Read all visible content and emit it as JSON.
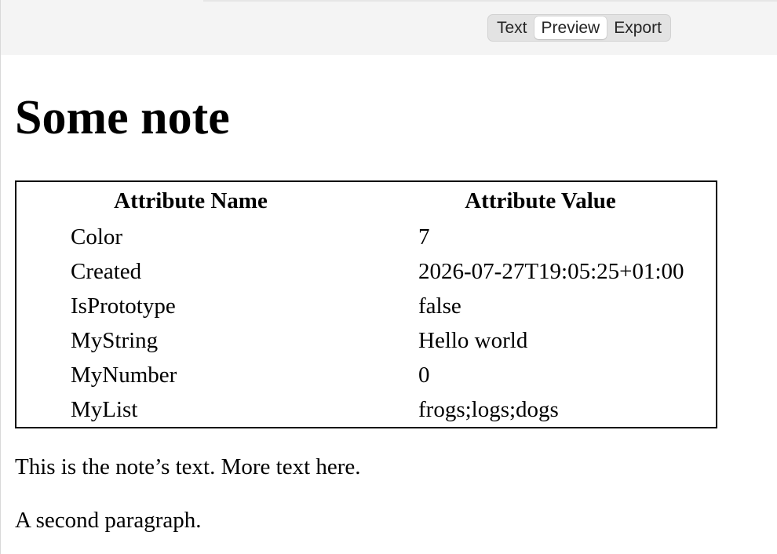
{
  "toolbar": {
    "tabs": [
      {
        "label": "Text",
        "active": false
      },
      {
        "label": "Preview",
        "active": true
      },
      {
        "label": "Export",
        "active": false
      }
    ]
  },
  "note": {
    "title": "Some note",
    "table": {
      "headers": [
        "Attribute Name",
        "Attribute Value"
      ],
      "rows": [
        {
          "name": "Color",
          "value": "7"
        },
        {
          "name": "Created",
          "value": "2026-07-27T19:05:25+01:00"
        },
        {
          "name": "IsPrototype",
          "value": "false"
        },
        {
          "name": "MyString",
          "value": "Hello world"
        },
        {
          "name": "MyNumber",
          "value": "0"
        },
        {
          "name": "MyList",
          "value": "frogs;logs;dogs"
        }
      ]
    },
    "paragraphs": [
      "This is the note’s text. More text here.",
      "A second paragraph."
    ]
  }
}
